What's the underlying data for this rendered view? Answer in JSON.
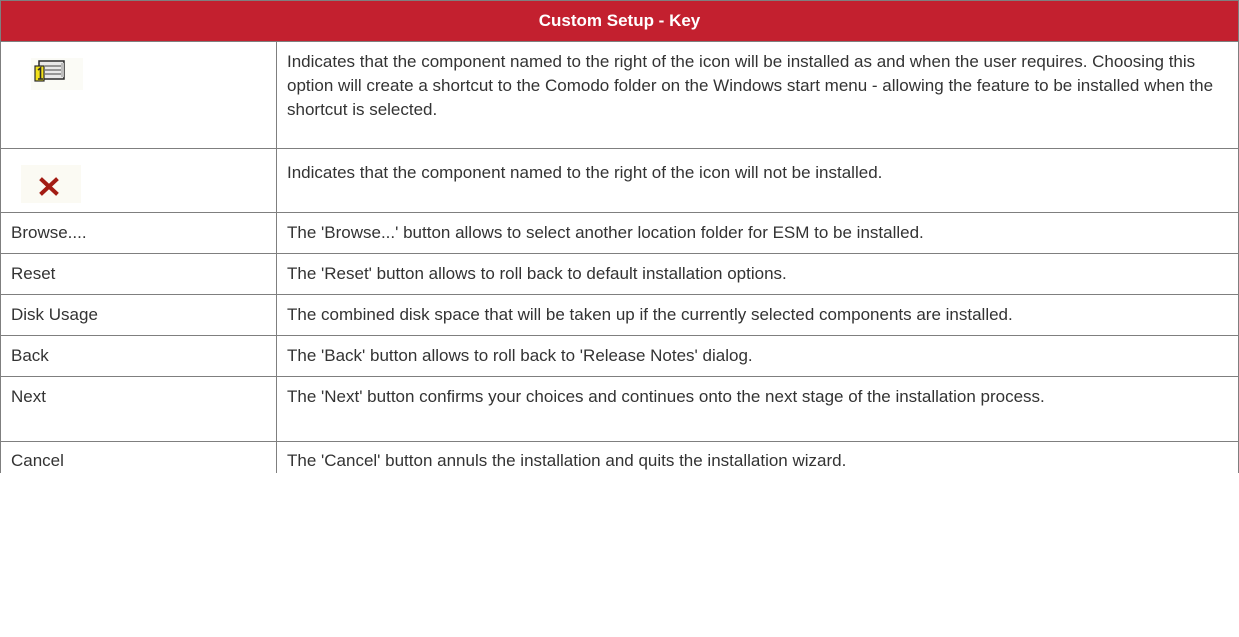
{
  "table": {
    "title": "Custom Setup - Key",
    "rows": [
      {
        "key": "",
        "icon": "install-on-demand-icon",
        "description": "Indicates that the component named to the right of the icon will be installed as and when the user requires. Choosing this option will create a shortcut to the Comodo folder on the Windows start menu - allowing the feature to be installed when the shortcut is selected."
      },
      {
        "key": "",
        "icon": "not-installed-x-icon",
        "description": "Indicates that the component named to the right of the icon will not be installed."
      },
      {
        "key": "Browse....",
        "description": "The 'Browse...' button allows to select another location folder for ESM to be installed."
      },
      {
        "key": "Reset",
        "description": "The 'Reset' button allows to roll back to default installation options."
      },
      {
        "key": "Disk Usage",
        "description": "The combined disk space that will be taken up if the currently selected components are installed."
      },
      {
        "key": "Back",
        "description": "The 'Back' button allows to roll back to 'Release Notes' dialog."
      },
      {
        "key": "Next",
        "description": "The 'Next' button confirms your choices and continues onto the next stage of the installation process."
      },
      {
        "key": "Cancel",
        "description": "The 'Cancel' button annuls the installation and quits the installation wizard."
      }
    ]
  },
  "colors": {
    "header_bg": "#c3202f",
    "header_text": "#ffffff",
    "border": "#7f7f7f",
    "body_text": "#333333",
    "x_icon": "#a31c14"
  }
}
